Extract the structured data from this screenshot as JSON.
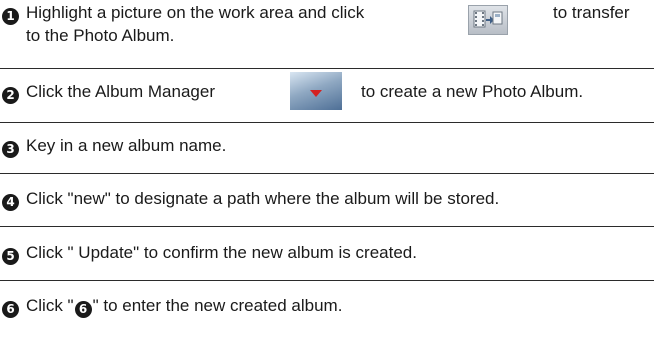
{
  "steps": [
    {
      "number": "1",
      "line1_before": "Highlight a picture on the work area and click",
      "icon": "transfer-to-album-icon",
      "line1_after": "to transfer",
      "line2": "to the Photo Album."
    },
    {
      "number": "2",
      "text_before": "Click the Album Manager",
      "icon": "album-manager-icon",
      "text_after": "to create a new Photo Album."
    },
    {
      "number": "3",
      "text": "Key in a new album name."
    },
    {
      "number": "4",
      "text": "Click \"new\"  to designate a path where the album will be stored."
    },
    {
      "number": "5",
      "text": "Click  \" Update\"  to confirm the new album is created."
    },
    {
      "number": "6",
      "text_before": "Click  \"",
      "inline_number": "6",
      "text_after": "\" to enter the new created album."
    }
  ],
  "colors": {
    "text": "#1a1a1a",
    "rule": "#2b2b2b",
    "number_badge": "#1a1a1a",
    "album_icon_arrow": "#d42020"
  }
}
